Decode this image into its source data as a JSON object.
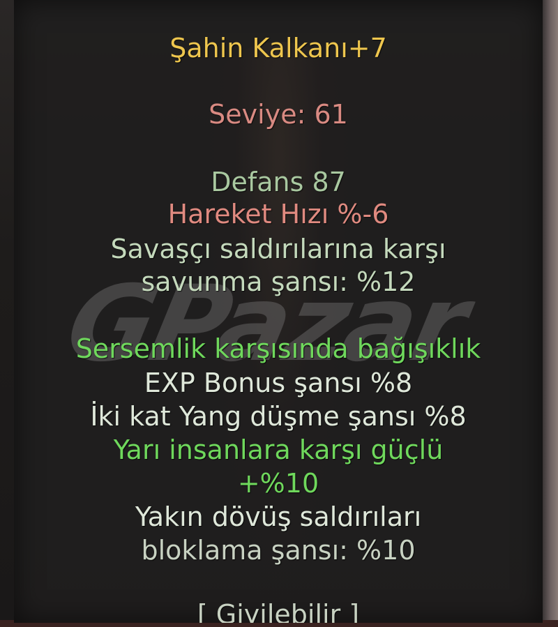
{
  "item": {
    "name": "Şahin Kalkanı+7",
    "level": "Seviye: 61",
    "defense": "Defans 87",
    "move_speed": "Hareket Hızı %-6",
    "bonus_warrior_line1": "Savaşçı saldırılarına karşı",
    "bonus_warrior_line2": "savunma şansı: %12",
    "stun_immunity": "Sersemlik karşısında bağışıklık",
    "exp_bonus": "EXP Bonus şansı %8",
    "double_yang": "İki kat Yang düşme şansı %8",
    "half_human_line1": "Yarı insanlara karşı güçlü",
    "half_human_line2": "+%10",
    "melee_block_line1": "Yakın dövüş saldırıları",
    "melee_block_line2": "bloklama şansı: %10",
    "socketable": "[ Giyilebilir ]"
  },
  "watermark": "GPazar",
  "colors": {
    "title": "#eec64e",
    "level": "#d98a82",
    "negative": "#e08a80",
    "stat": "#c4d9bc",
    "special_green": "#6fd85c"
  }
}
